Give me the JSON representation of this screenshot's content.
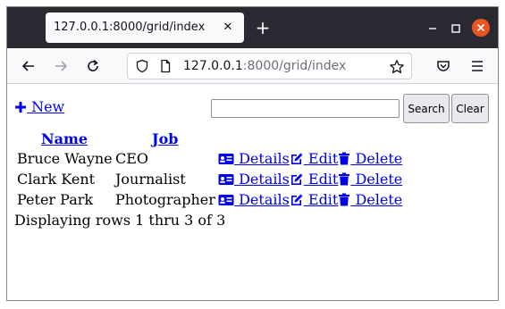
{
  "browser": {
    "tab_title": "127.0.0.1:8000/grid/index",
    "url_host": "127.0.0.1",
    "url_path": ":8000/grid/index",
    "accent_close_color": "#e95420"
  },
  "page": {
    "new_label": " New",
    "search": {
      "value": "",
      "placeholder": ""
    },
    "search_label": "Search",
    "clear_label": "Clear",
    "columns": [
      "Name",
      "Job"
    ],
    "rows": [
      {
        "name": "Bruce Wayne",
        "job": "CEO"
      },
      {
        "name": "Clark Kent",
        "job": "Journalist"
      },
      {
        "name": "Peter Park",
        "job": "Photographer"
      }
    ],
    "actions": {
      "details": " Details",
      "edit": " Edit",
      "delete": " Delete"
    },
    "footer": "Displaying rows 1 thru 3 of 3",
    "link_color": "#0000ee"
  }
}
